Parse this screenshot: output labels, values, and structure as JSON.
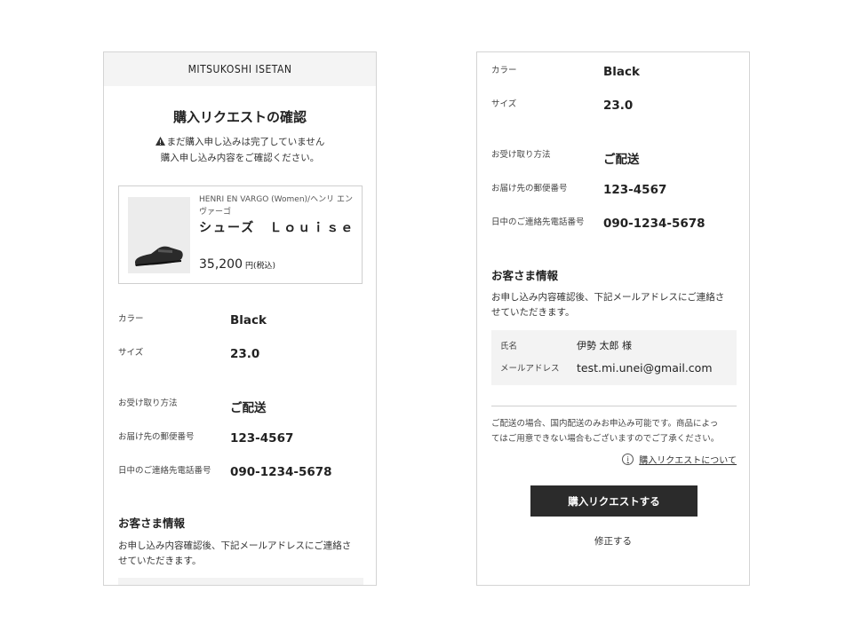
{
  "header": {
    "brand": "MITSUKOSHI ISETAN"
  },
  "page": {
    "title": "購入リクエストの確認",
    "notice_line1": "まだ購入申し込みは完了していません",
    "notice_line2": "購入申し込み内容をご確認ください。",
    "warning_icon": "warning-icon"
  },
  "product": {
    "brand": "HENRI EN VARGO (Women)/ヘンリ エン ヴァーゴ",
    "name": "シューズ　Ｌｏｕｉｓｅ",
    "price": "35,200",
    "price_unit": "円(税込)",
    "image_icon": "shoe-icon"
  },
  "details": {
    "color_label": "カラー",
    "color_value": "Black",
    "size_label": "サイズ",
    "size_value": "23.0",
    "method_label": "お受け取り方法",
    "method_value": "ご配送",
    "postal_label": "お届け先の郵便番号",
    "postal_value": "123-4567",
    "phone_label": "日中のご連絡先電話番号",
    "phone_value": "090-1234-5678"
  },
  "customer": {
    "section_title": "お客さま情報",
    "desc_line1": "お申し込み内容確認後、下記メールアドレスにご連絡さ",
    "desc_line2": "せていただきます。",
    "name_label": "氏名",
    "name_value": "伊勢 太郎 様",
    "email_label": "メールアドレス",
    "email_value": "test.mi.unei@gmail.com"
  },
  "footer": {
    "disclaimer_line1": "ご配送の場合、国内配送のみお申込み可能です。商品によっ",
    "disclaimer_line2": "てはご用意できない場合もございますのでご了承ください。",
    "about_link": "購入リクエストについて",
    "about_icon": "info-icon",
    "submit_button": "購入リクエストする",
    "edit_link": "修正する"
  },
  "colors": {
    "button_bg": "#2b2b2b",
    "panel_bg": "#f3f3f3",
    "header_bg": "#f4f4f4"
  }
}
